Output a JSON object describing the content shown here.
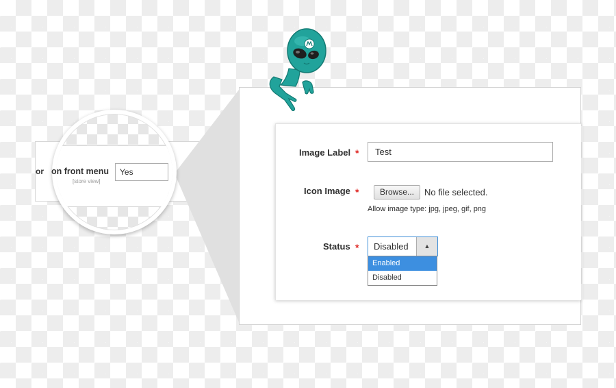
{
  "colors": {
    "accent": "#3d8fe0",
    "required": "#e02b27",
    "mascot": "#21a39b"
  },
  "zoom": {
    "cut_prefix": "or",
    "label": "on front menu",
    "scope": "[store view]",
    "value": "Yes"
  },
  "form": {
    "image_label": {
      "label": "Image Label",
      "required_mark": "*",
      "value": "Test"
    },
    "icon_image": {
      "label": "Icon Image",
      "required_mark": "*",
      "browse_label": "Browse...",
      "file_status": "No file selected.",
      "note": "Allow image type: jpg, jpeg, gif, png"
    },
    "status": {
      "label": "Status",
      "required_mark": "*",
      "value": "Disabled",
      "arrow_icon": "▲",
      "options": [
        "Enabled",
        "Disabled"
      ],
      "highlighted_option": "Enabled"
    }
  },
  "mascot": {
    "icon": "alien-mascot"
  }
}
